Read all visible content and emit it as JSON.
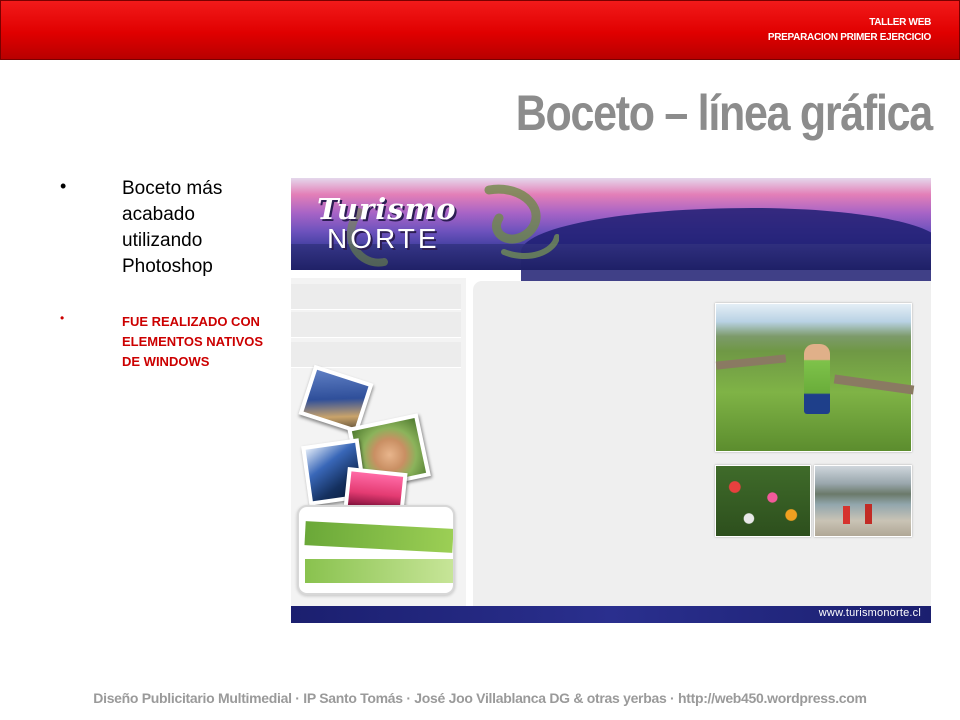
{
  "header": {
    "line1": "TALLER WEB",
    "line2": "PREPARACION PRIMER EJERCICIO",
    "bar_color": "#e00000"
  },
  "title": "Boceto  – línea gráfica",
  "bullets": [
    {
      "text": "Boceto más acabado utilizando Photoshop",
      "color": "#000000"
    },
    {
      "text": "FUE REALIZADO CON ELEMENTOS NATIVOS DE WINDOWS",
      "color": "#cc0000"
    }
  ],
  "mockup": {
    "logo_line1": "Turismo",
    "logo_line2": "NORTE",
    "url": "www.turismonorte.cl",
    "accent_color": "#1e2064"
  },
  "footer": "Diseño Publicitario Multimedial · IP Santo Tomás · José Joo Villablanca DG & otras yerbas · http://web450.wordpress.com"
}
